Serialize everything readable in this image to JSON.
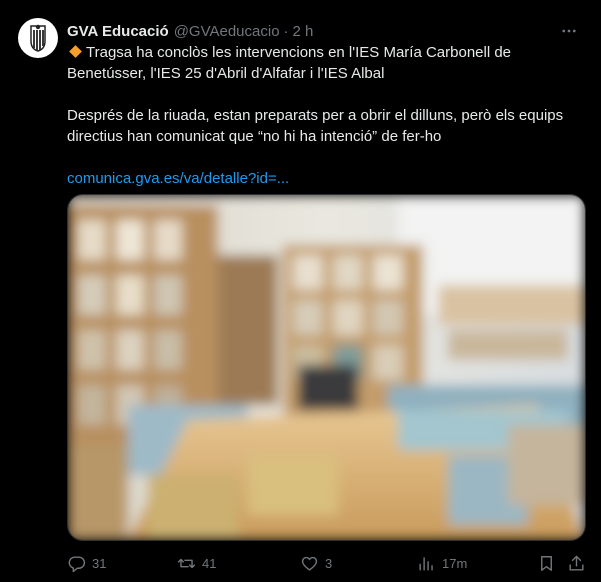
{
  "author": {
    "name": "GVA Educació",
    "handle": "@GVAeducacio",
    "separator": "·",
    "time": "2 h"
  },
  "tweet": {
    "line1": "Tragsa ha conclòs les intervencions en l'IES María Carbonell de Benetússer, l'IES 25 d'Abril d'Alfafar i l'IES Albal",
    "line2": "Després de la riuada, estan preparats per a obrir el dilluns, però els equips directius han comunicat que “no hi ha intenció” de fer-ho",
    "link": "comunica.gva.es/va/detalle?id=..."
  },
  "actions": {
    "replies": "31",
    "retweets": "41",
    "likes": "3",
    "views": "17m"
  },
  "icons": {
    "bullet": "orange-diamond-icon",
    "more": "more-dots-icon",
    "reply": "reply-icon",
    "retweet": "retweet-icon",
    "like": "heart-icon",
    "views": "views-icon",
    "bookmark": "bookmark-icon",
    "share": "share-icon"
  },
  "colors": {
    "background": "#000000",
    "text": "#e7e9ea",
    "muted": "#71767b",
    "link": "#1d9bf0",
    "bullet": "#f59e2b"
  }
}
